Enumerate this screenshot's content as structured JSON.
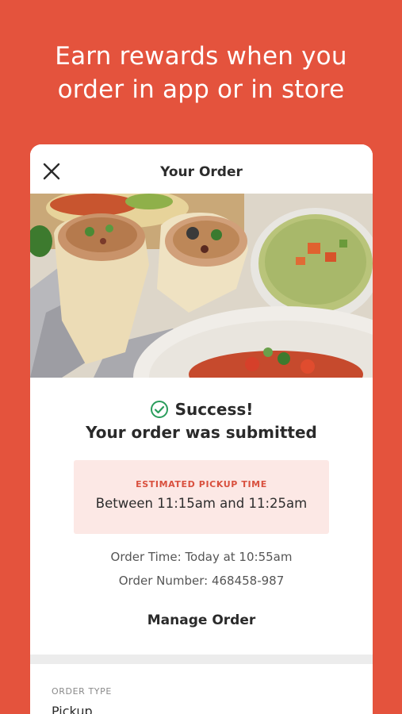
{
  "headline": {
    "line1": "Earn rewards when you",
    "line2": "order in app or in store"
  },
  "card": {
    "title": "Your Order",
    "close_icon": "close-icon",
    "hero_image": "burrito-guacamole-photo"
  },
  "confirmation": {
    "status": "Success!",
    "message": "Your order was submitted",
    "check_icon": "check-circle-icon",
    "check_color": "#2a9d5c"
  },
  "pickup": {
    "label": "ESTIMATED PICKUP TIME",
    "time": "Between 11:15am and 11:25am"
  },
  "details": {
    "order_time": "Order Time: Today at 10:55am",
    "order_number": "Order Number: 468458-987"
  },
  "actions": {
    "manage_order": "Manage Order"
  },
  "order_type": {
    "label": "ORDER TYPE",
    "value": "Pickup"
  },
  "colors": {
    "brand_red": "#e4533d",
    "pickup_bg": "#fce8e5",
    "pickup_label": "#d9503e"
  }
}
